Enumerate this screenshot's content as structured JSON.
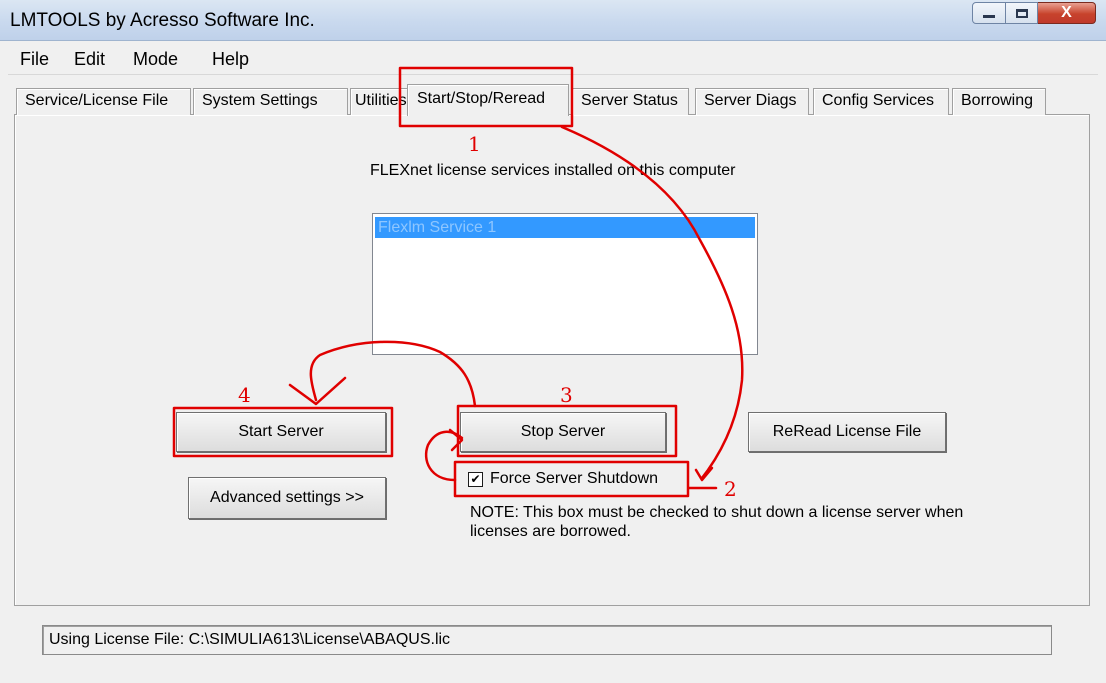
{
  "window": {
    "title": "LMTOOLS by Acresso Software Inc.",
    "close_glyph": "X"
  },
  "menu": [
    "File",
    "Edit",
    "Mode",
    "Help"
  ],
  "tabs": [
    {
      "label": "Service/License File",
      "active": false
    },
    {
      "label": "System Settings",
      "active": false
    },
    {
      "label": "Utilities",
      "active": false
    },
    {
      "label": "Start/Stop/Reread",
      "active": true
    },
    {
      "label": "Server Status",
      "active": false
    },
    {
      "label": "Server Diags",
      "active": false
    },
    {
      "label": "Config Services",
      "active": false
    },
    {
      "label": "Borrowing",
      "active": false
    }
  ],
  "panel": {
    "services_caption": "FLEXnet license services installed on this computer",
    "services": [
      "Flexlm Service 1"
    ],
    "selected_service": "Flexlm Service 1"
  },
  "buttons": {
    "start_server": "Start Server",
    "stop_server": "Stop Server",
    "reread_license_file": "ReRead License File",
    "advanced_settings": "Advanced settings >>"
  },
  "force_shutdown": {
    "label": "Force Server Shutdown",
    "checked": true,
    "check_glyph": "✔"
  },
  "note": "NOTE:  This box must be checked to shut down a license server when licenses are borrowed.",
  "status": {
    "text": "Using License File:  C:\\SIMULIA613\\License\\ABAQUS.lic"
  },
  "annotations": {
    "color": "#e00000",
    "labels": [
      "1",
      "2",
      "3",
      "4"
    ]
  }
}
